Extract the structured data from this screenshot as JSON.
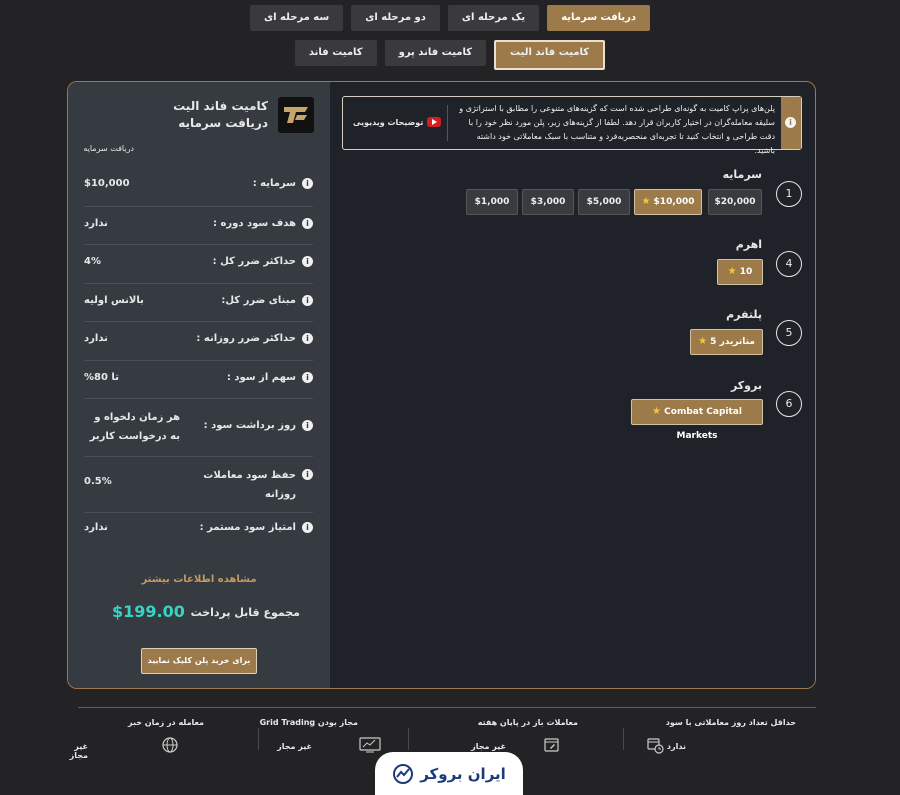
{
  "tabs_row1": [
    {
      "label": "دریافت سرمایه",
      "active": true
    },
    {
      "label": "یک مرحله ای",
      "active": false
    },
    {
      "label": "دو مرحله ای",
      "active": false
    },
    {
      "label": "سه مرحله ای",
      "active": false
    }
  ],
  "tabs_row2": [
    {
      "label": "کامیت فاند الیت",
      "active": true
    },
    {
      "label": "کامیت فاند پرو",
      "active": false
    },
    {
      "label": "کامیت فاند",
      "active": false
    }
  ],
  "summary": {
    "plan_title": "کامیت فاند الیت",
    "plan_subtitle": "دریافت سرمایه",
    "plan_small": "دریافت سرمایه",
    "rows": [
      {
        "label": "سرمایه :",
        "value": "$10,000"
      },
      {
        "label": "هدف سود دوره :",
        "value": "ندارد"
      },
      {
        "label": "حداکثر ضرر کل :",
        "value": "4%"
      },
      {
        "label": "مبنای ضرر کل:",
        "value": "بالانس اولیه"
      },
      {
        "label": "حداکثر ضرر روزانه :",
        "value": "ندارد"
      },
      {
        "label": "سهم از سود :",
        "value": "تا 80%"
      },
      {
        "label": "روز برداشت سود :",
        "value": "هر زمان دلخواه و به درخواست کاربر"
      },
      {
        "label": "حفظ سود معاملات روزانه",
        "value": "0.5%"
      },
      {
        "label": "امتیاز سود مستمر :",
        "value": "ندارد"
      }
    ],
    "more_info": "مشاهده اطلاعات بیشتر",
    "total_label": "مجموع قابل پرداخت",
    "total_value": "$199.00",
    "buy_button": "برای خرید پلن کلیک نمایید"
  },
  "notice": {
    "text": "پلن‌های پراپ کامیت به گونه‌ای طراحی شده است که گزینه‌های متنوعی را مطابق با استراتژی و سلیقه معامله‌گران در اختیار کاربران قرار دهد. لطفا از گزینه‌های زیر، پلن مورد نظر خود را با دقت طراحی و انتخاب کنید تا تجربه‌ای منحصربه‌فرد و متناسب با سبک معاملاتی خود داشته باشید.",
    "video_label": "توضیحات ویدیویی"
  },
  "steps": [
    {
      "number": "1",
      "title": "سرمایه",
      "options": [
        "$20,000",
        "$10,000",
        "$5,000",
        "$3,000",
        "$1,000"
      ],
      "selected": 1
    },
    {
      "number": "4",
      "title": "اهرم",
      "options": [
        "10"
      ],
      "selected": 0
    },
    {
      "number": "5",
      "title": "پلتفرم",
      "options": [
        "متاتریدر 5"
      ],
      "selected": 0
    },
    {
      "number": "6",
      "title": "بروکر",
      "options": [
        "Combat Capital Markets"
      ],
      "selected": 0
    }
  ],
  "features": [
    {
      "title": "حداقل تعداد روز معاملاتی با سود",
      "value": "ندارد",
      "icon": "calendar-clock-icon"
    },
    {
      "title": "معاملات باز در پایان هفته",
      "value": "غیر مجاز",
      "icon": "calendar-edit-icon"
    },
    {
      "title": "مجاز بودن Grid Trading",
      "value": "غیر مجاز",
      "icon": "monitor-chart-icon"
    },
    {
      "title": "معامله در زمان خبر",
      "value": "غیر مجاز",
      "icon": "globe-icon"
    }
  ],
  "brand": "ایران بروکر",
  "colors": {
    "accent": "#9c7a4a",
    "total": "#39d3c4"
  }
}
